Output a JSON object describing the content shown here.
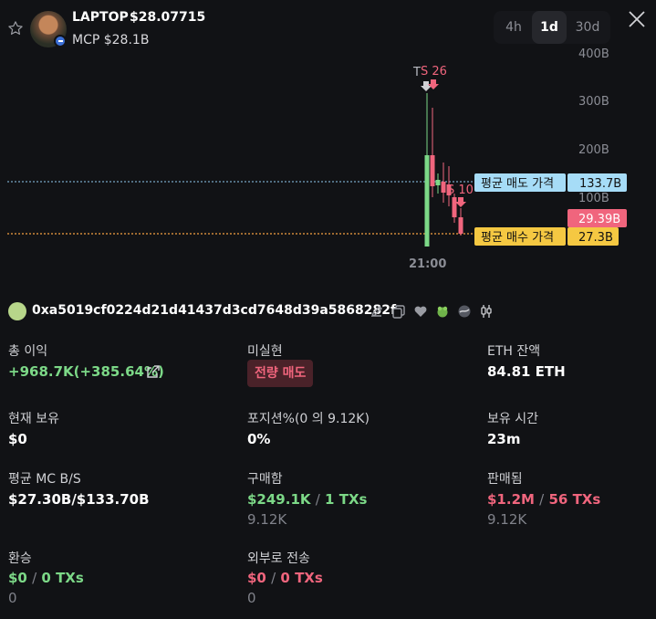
{
  "header": {
    "token_name": "LAPTOP",
    "price": "$28.07715",
    "mcp": "MCP $28.1B",
    "timeframes": [
      "4h",
      "1d",
      "30d"
    ],
    "active_timeframe": "1d"
  },
  "chart": {
    "y_labels": [
      "400B",
      "300B",
      "200B",
      "100B"
    ],
    "x_label": "21:00",
    "marker_t": "T",
    "marker_s1": "S 26",
    "marker_s2": "S 10",
    "avg_sell_label": "평균 매도 가격",
    "avg_sell_value": "133.7B",
    "current_value": "29.39B",
    "avg_buy_label": "평균 매수 가격",
    "avg_buy_value": "27.3B",
    "colors": {
      "up": "#7cd887",
      "down": "#f0657d",
      "sell_line": "#8ecbf0",
      "buy_line": "#f5c842"
    }
  },
  "wallet": {
    "address": "0xa5019cf0224d21d41437d3cd7648d39a5868282f"
  },
  "stats": {
    "total_profit_label": "총 이익",
    "total_profit_value": "+968.7K(+385.64%)",
    "unrealized_label": "미실현",
    "unrealized_tag": "전량 매도",
    "eth_balance_label": "ETH 잔액",
    "eth_balance_value": "84.81 ETH",
    "holding_label": "현재 보유",
    "holding_value": "$0",
    "position_label": "포지션%(0 의 9.12K)",
    "position_value": "0%",
    "hold_time_label": "보유 시간",
    "hold_time_value": "23m",
    "avg_mc_label": "평균 MC B/S",
    "avg_mc_value": "$27.30B/$133.70B",
    "bought_label": "구매함",
    "bought_amount": "$249.1K",
    "bought_txs": "1 TXs",
    "bought_sub": "9.12K",
    "sold_label": "판매됨",
    "sold_amount": "$1.2M",
    "sold_txs": "56 TXs",
    "sold_sub": "9.12K",
    "transfer_in_label": "환승",
    "transfer_in_amount": "$0",
    "transfer_in_txs": "0 TXs",
    "transfer_in_sub": "0",
    "transfer_out_label": "외부로 전송",
    "transfer_out_amount": "$0",
    "transfer_out_txs": "0 TXs",
    "transfer_out_sub": "0",
    "slash": "/"
  }
}
